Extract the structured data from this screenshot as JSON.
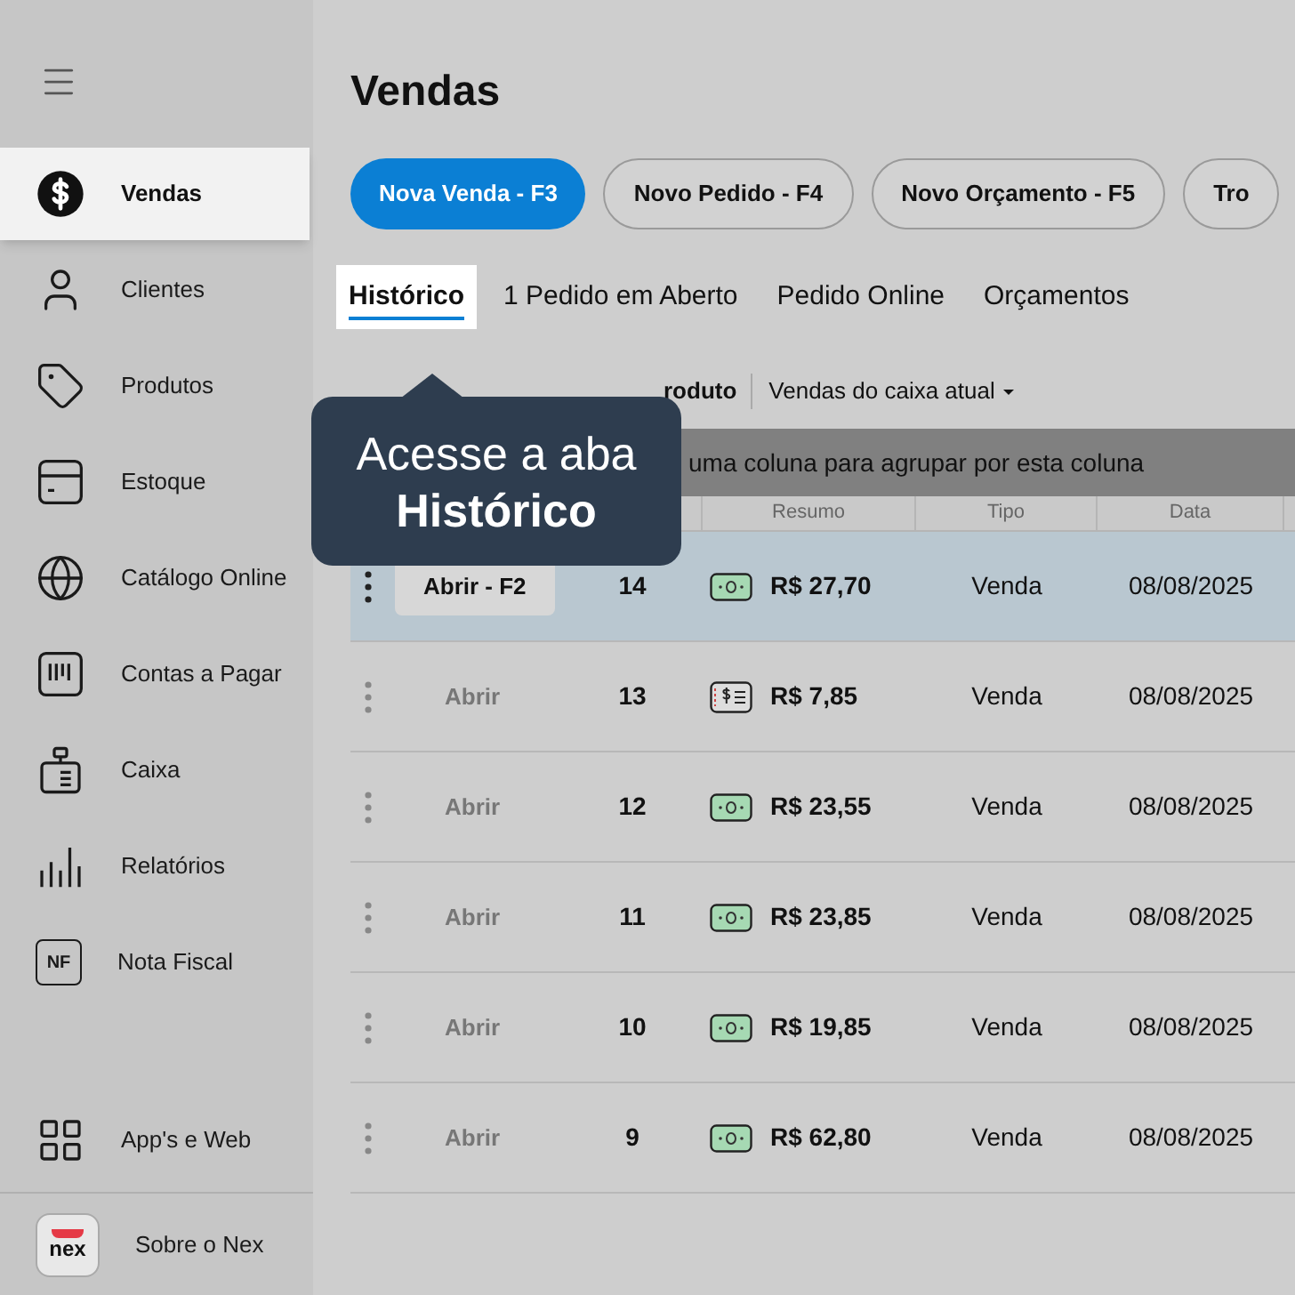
{
  "sidebar": {
    "items": [
      {
        "label": "Vendas",
        "kind": "dollar",
        "selected": true
      },
      {
        "label": "Clientes",
        "kind": "user",
        "selected": false
      },
      {
        "label": "Produtos",
        "kind": "tag",
        "selected": false
      },
      {
        "label": "Estoque",
        "kind": "box",
        "selected": false
      },
      {
        "label": "Catálogo Online",
        "kind": "globe",
        "selected": false
      },
      {
        "label": "Contas a Pagar",
        "kind": "bill",
        "selected": false
      },
      {
        "label": "Caixa",
        "kind": "register",
        "selected": false
      },
      {
        "label": "Relatórios",
        "kind": "chart",
        "selected": false
      },
      {
        "label": "Nota Fiscal",
        "kind": "nf",
        "icon_text": "NF",
        "selected": false
      }
    ],
    "footer_items": [
      {
        "label": "App's e Web",
        "kind": "grid"
      },
      {
        "label": "Sobre o Nex",
        "kind": "logo",
        "icon_text": "nex"
      }
    ]
  },
  "page_title": "Vendas",
  "action_buttons": [
    {
      "label": "Nova Venda - F3",
      "primary": true
    },
    {
      "label": "Novo Pedido - F4",
      "primary": false
    },
    {
      "label": "Novo Orçamento - F5",
      "primary": false
    },
    {
      "label": "Tro",
      "primary": false
    }
  ],
  "tabs": [
    {
      "label": "Histórico",
      "selected": true
    },
    {
      "label": "1 Pedido em Aberto",
      "selected": false
    },
    {
      "label": "Pedido Online",
      "selected": false
    },
    {
      "label": "Orçamentos",
      "selected": false
    }
  ],
  "tooltip": {
    "text": "Acesse a aba **Histórico**"
  },
  "filters": {
    "partial_label": "roduto",
    "dropdown": "Vendas do caixa atual"
  },
  "group_hint": "uma coluna para agrupar por esta coluna",
  "table": {
    "columns": [
      "Resumo",
      "Tipo",
      "Data"
    ],
    "rows": [
      {
        "action": "Abrir - F2",
        "number": "14",
        "kind": "cash",
        "amount": "R$ 27,70",
        "type": "Venda",
        "date": "08/08/2025",
        "selected": true
      },
      {
        "action": "Abrir",
        "number": "13",
        "kind": "card",
        "amount": "R$ 7,85",
        "type": "Venda",
        "date": "08/08/2025",
        "selected": false
      },
      {
        "action": "Abrir",
        "number": "12",
        "kind": "cash",
        "amount": "R$ 23,55",
        "type": "Venda",
        "date": "08/08/2025",
        "selected": false
      },
      {
        "action": "Abrir",
        "number": "11",
        "kind": "cash",
        "amount": "R$ 23,85",
        "type": "Venda",
        "date": "08/08/2025",
        "selected": false
      },
      {
        "action": "Abrir",
        "number": "10",
        "kind": "cash",
        "amount": "R$ 19,85",
        "type": "Venda",
        "date": "08/08/2025",
        "selected": false
      },
      {
        "action": "Abrir",
        "number": "9",
        "kind": "cash",
        "amount": "R$ 62,80",
        "type": "Venda",
        "date": "08/08/2025",
        "selected": false
      }
    ]
  }
}
